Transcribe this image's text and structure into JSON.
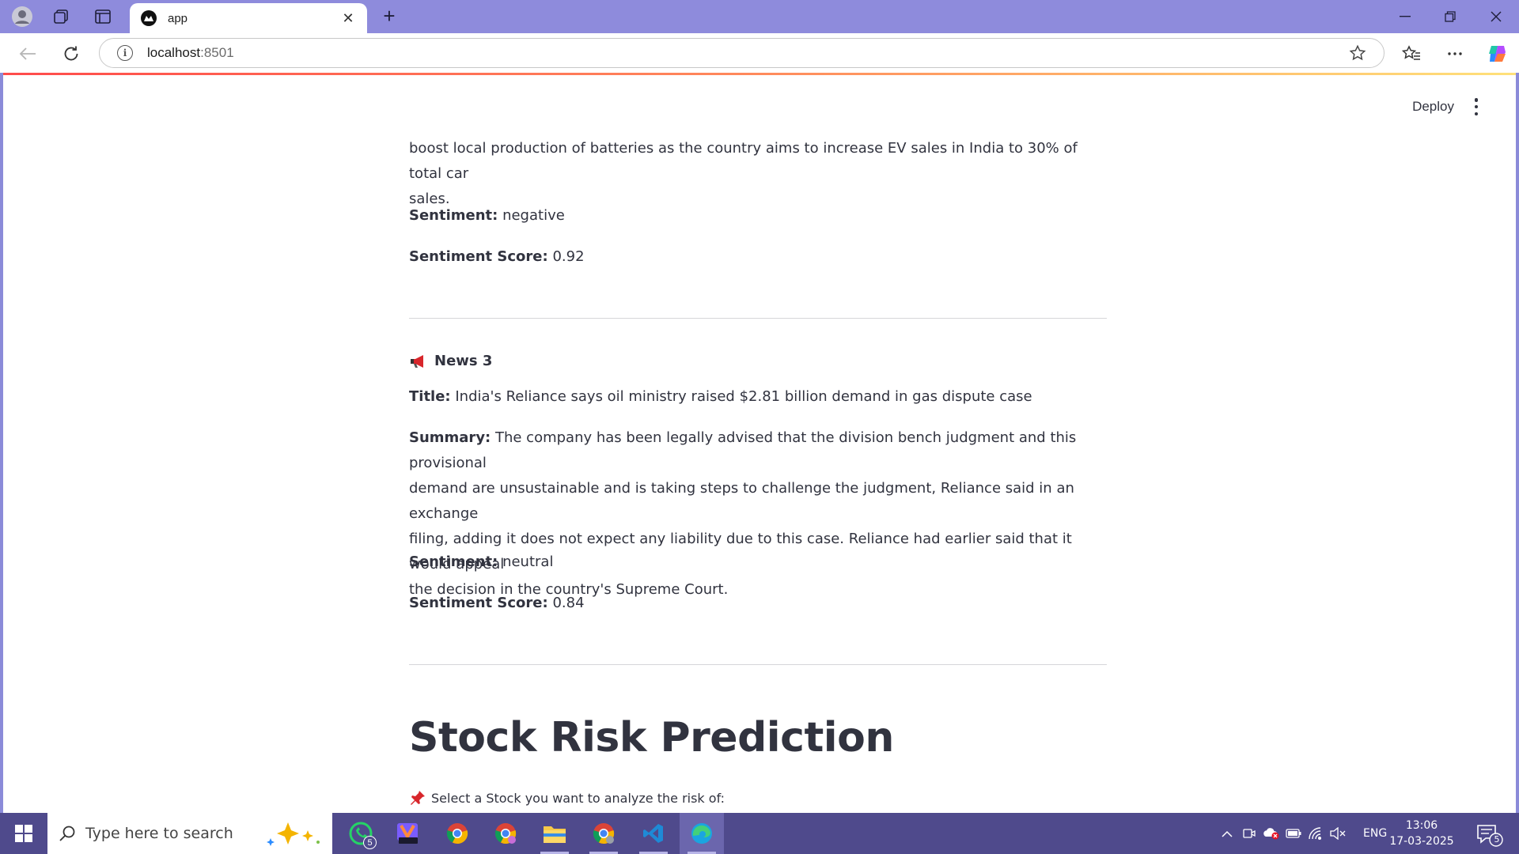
{
  "browser": {
    "tab_title": "app",
    "url_host": "localhost",
    "url_port": ":8501"
  },
  "streamlit": {
    "deploy_label": "Deploy"
  },
  "article_prev": {
    "cut_line": "— — — — — — — — — — — — — — — — — — — — —",
    "summary_tail_1": "boost local production of batteries as the country aims to increase EV sales in India to 30% of total car",
    "summary_tail_2": "sales.",
    "sentiment_label": "Sentiment:",
    "sentiment_value": "negative",
    "score_label": "Sentiment Score:",
    "score_value": "0.92"
  },
  "news3": {
    "heading": "News 3",
    "title_label": "Title:",
    "title_value": "India's Reliance says oil ministry raised $2.81 billion demand in gas dispute case",
    "summary_label": "Summary:",
    "summary_line_1": "The company has been legally advised that the division bench judgment and this provisional",
    "summary_line_2": "demand are unsustainable and is taking steps to challenge the judgment, Reliance said in an exchange",
    "summary_line_3": "filing, adding it does not expect any liability due to this case. Reliance had earlier said that it would appeal",
    "summary_line_4": "the decision in the country's Supreme Court.",
    "sentiment_label": "Sentiment:",
    "sentiment_value": "neutral",
    "score_label": "Sentiment Score:",
    "score_value": "0.84"
  },
  "risk": {
    "heading": "Stock Risk Prediction",
    "select_label": "Select a Stock you want to analyze the risk of:"
  },
  "taskbar": {
    "search_placeholder": "Type here to search",
    "whatsapp_badge": "5",
    "language": "ENG",
    "time": "13:06",
    "date": "17-03-2025",
    "notification_count": "5"
  }
}
